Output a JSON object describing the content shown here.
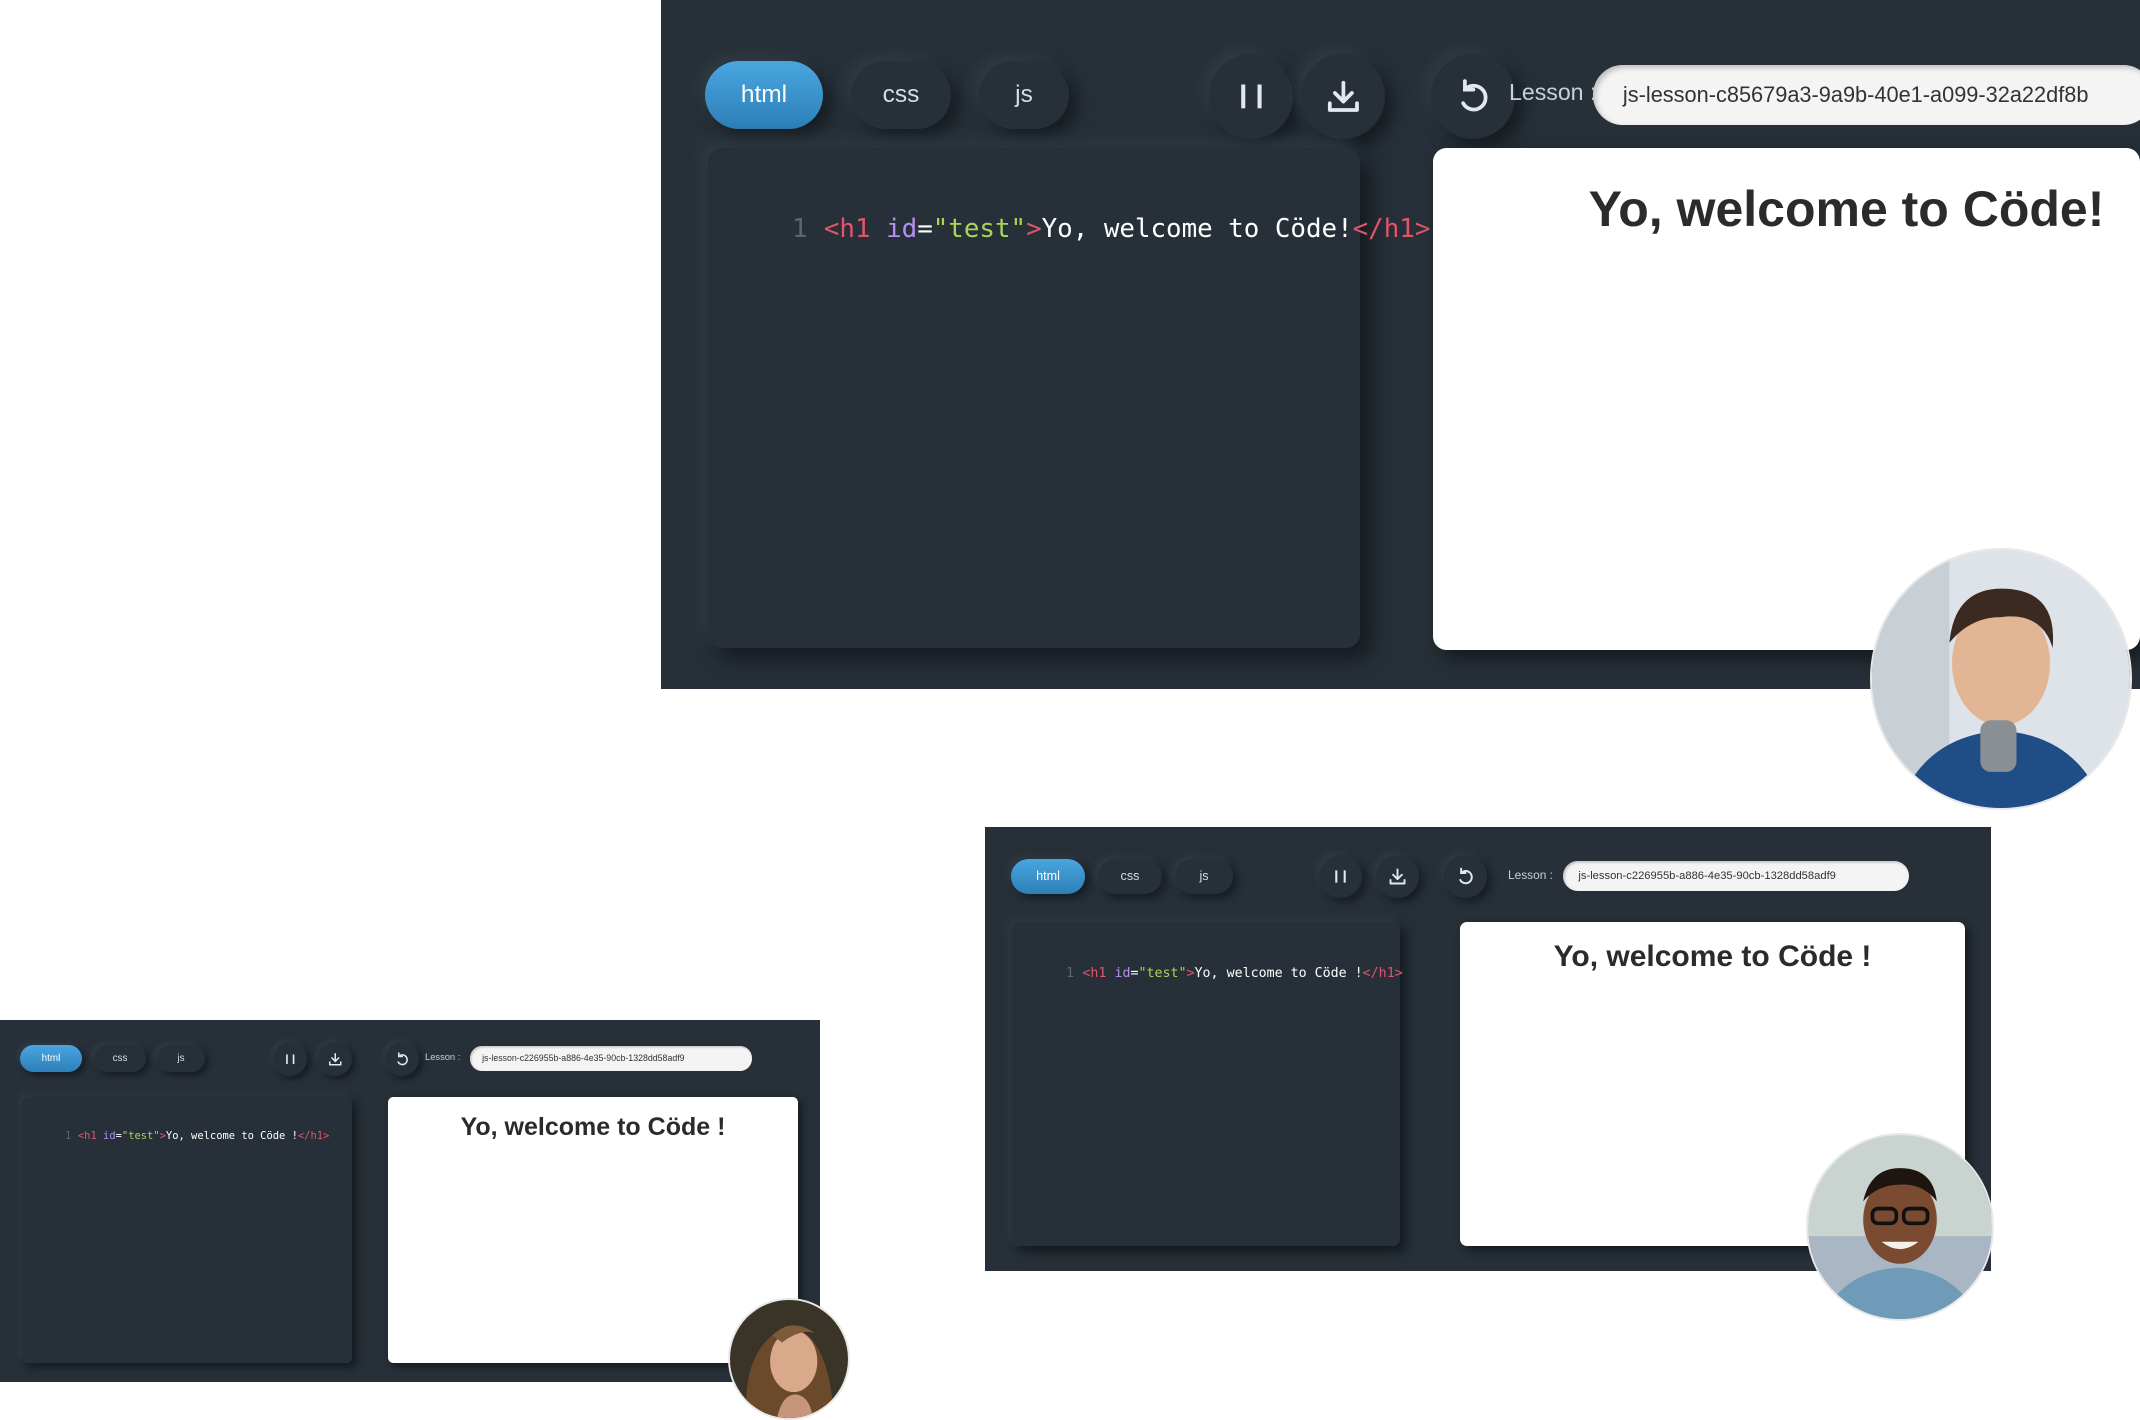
{
  "tabs": [
    "html",
    "css",
    "js"
  ],
  "lesson_label": "Lesson :",
  "icons": {
    "pause": "pause-icon",
    "download": "download-icon",
    "reload": "reload-icon"
  },
  "colors": {
    "panel": "#273038",
    "accent": "#3a97d4",
    "tag": "#e0556c",
    "attr": "#b48ef0",
    "string": "#a8d45a"
  },
  "screens": [
    {
      "lesson_id": "js-lesson-c85679a3-9a9b-40e1-a099-32a22df8b",
      "code": {
        "line": "1",
        "open": "<h1",
        "attr": " id",
        "eq": "=",
        "str": "\"test\"",
        "gt": ">",
        "text": "Yo, welcome to Cöde!",
        "close": "</h1>"
      },
      "preview_heading": "Yo, welcome to Cöde!"
    },
    {
      "lesson_id": "js-lesson-c226955b-a886-4e35-90cb-1328dd58adf9",
      "code": {
        "line": "1",
        "open": "<h1",
        "attr": " id",
        "eq": "=",
        "str": "\"test\"",
        "gt": ">",
        "text": "Yo, welcome to Cöde !",
        "close": "</h1>"
      },
      "preview_heading": "Yo, welcome to Cöde !"
    },
    {
      "lesson_id": "js-lesson-c226955b-a886-4e35-90cb-1328dd58adf9",
      "code": {
        "line": "1",
        "open": "<h1",
        "attr": " id",
        "eq": "=",
        "str": "\"test\"",
        "gt": ">",
        "text": "Yo, welcome to Cöde !",
        "close": "</h1>"
      },
      "preview_heading": "Yo, welcome to Cöde !"
    }
  ]
}
